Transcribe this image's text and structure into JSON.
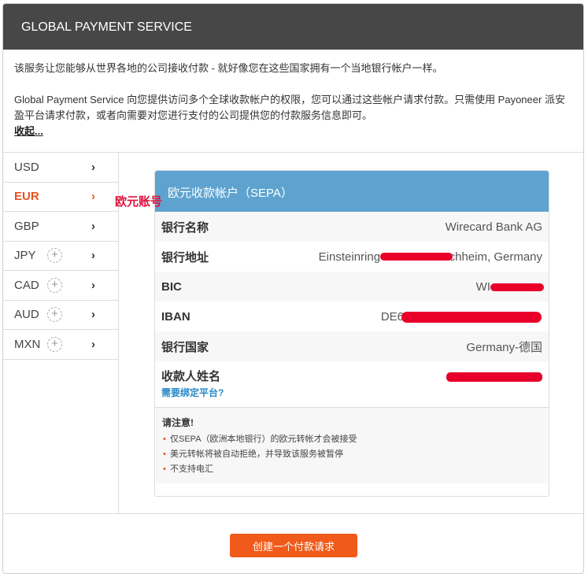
{
  "header": {
    "title": "GLOBAL PAYMENT SERVICE"
  },
  "description": {
    "line1": "该服务让您能够从世界各地的公司接收付款 - 就好像您在这些国家拥有一个当地银行帐户一样。",
    "line2": "Global Payment Service 向您提供访问多个全球收款帐户的权限，您可以通过这些帐户请求付款。只需使用 Payoneer 派安盈平台请求付款，或者向需要对您进行支付的公司提供您的付款服务信息即可。",
    "collapse": "收起..."
  },
  "currencies": [
    {
      "code": "USD",
      "add": false
    },
    {
      "code": "EUR",
      "add": false,
      "active": true
    },
    {
      "code": "GBP",
      "add": false
    },
    {
      "code": "JPY",
      "add": true
    },
    {
      "code": "CAD",
      "add": true
    },
    {
      "code": "AUD",
      "add": true
    },
    {
      "code": "MXN",
      "add": true
    }
  ],
  "annotation": "欧元账号",
  "card": {
    "title": "欧元收款帐户（SEPA）",
    "rows": [
      {
        "label": "银行名称",
        "value": "Wirecard Bank AG"
      },
      {
        "label": "银行地址",
        "value": "Einsteinring 35 85609 Aschheim, Germany"
      },
      {
        "label": "BIC",
        "value": "WI"
      },
      {
        "label": "IBAN",
        "value": "DE6"
      },
      {
        "label": "银行国家",
        "value": "Germany-德国"
      }
    ],
    "payee_label": "收款人姓名",
    "bind_link": "需要绑定平台?",
    "note_title": "请注意!",
    "notes": [
      "仅SEPA（欧洲本地银行）的欧元转帐才会被接受",
      "美元转帐将被自动拒绝，并导致该服务被暂停",
      "不支持电汇"
    ]
  },
  "button": "创建一个付款请求",
  "colors": {
    "accent": "#f05a1a",
    "card_header": "#5ea3cf",
    "header_bg": "#474747"
  }
}
